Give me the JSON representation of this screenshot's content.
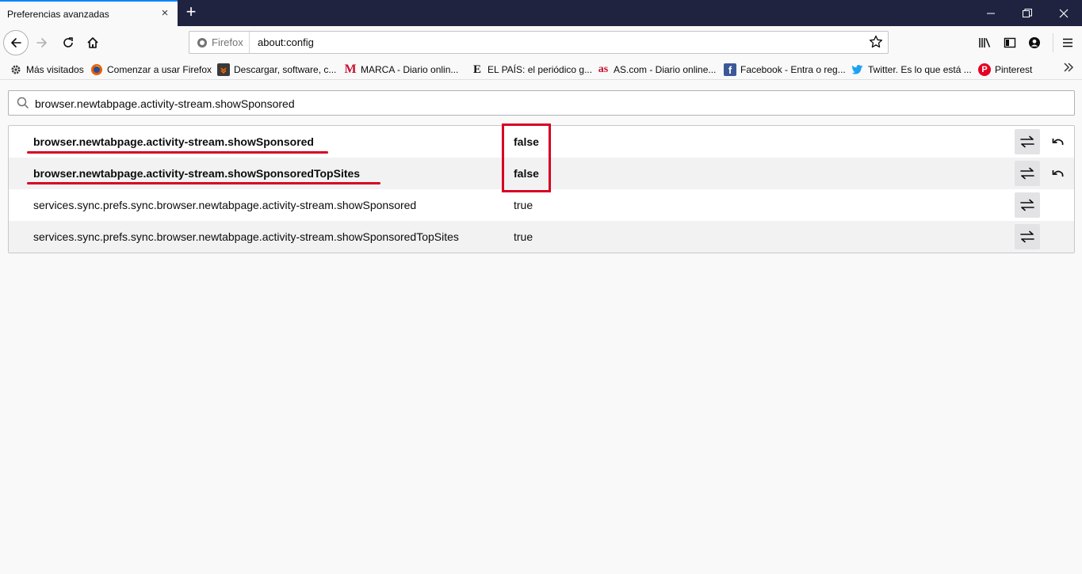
{
  "tab": {
    "title": "Preferencias avanzadas",
    "close": "×",
    "new": "+"
  },
  "nav": {
    "identity_label": "Firefox",
    "url": "about:config"
  },
  "bookmarks": [
    {
      "label": "Más visitados",
      "icon": "gear-icon"
    },
    {
      "label": "Comenzar a usar Firefox",
      "icon": "firefox-icon"
    },
    {
      "label": "Descargar, software, c...",
      "icon": "download-site-icon"
    },
    {
      "label": "MARCA - Diario onlin...",
      "icon": "marca-icon",
      "glyph": "M"
    },
    {
      "label": "EL PAÍS: el periódico g...",
      "icon": "elpais-icon",
      "glyph": "E"
    },
    {
      "label": "AS.com - Diario online...",
      "icon": "as-icon",
      "glyph": "as"
    },
    {
      "label": "Facebook - Entra o reg...",
      "icon": "facebook-icon",
      "glyph": "f"
    },
    {
      "label": "Twitter. Es lo que está ...",
      "icon": "twitter-icon"
    },
    {
      "label": "Pinterest",
      "icon": "pinterest-icon",
      "glyph": "P"
    }
  ],
  "search": {
    "value": "browser.newtabpage.activity-stream.showSponsored"
  },
  "prefs": [
    {
      "name": "browser.newtabpage.activity-stream.showSponsored",
      "value": "false",
      "modified": true
    },
    {
      "name": "browser.newtabpage.activity-stream.showSponsoredTopSites",
      "value": "false",
      "modified": true
    },
    {
      "name": "services.sync.prefs.sync.browser.newtabpage.activity-stream.showSponsored",
      "value": "true",
      "modified": false
    },
    {
      "name": "services.sync.prefs.sync.browser.newtabpage.activity-stream.showSponsoredTopSites",
      "value": "true",
      "modified": false
    }
  ],
  "colors": {
    "annotation": "#d70022",
    "titlebar": "#202340",
    "accent": "#0a84ff"
  }
}
